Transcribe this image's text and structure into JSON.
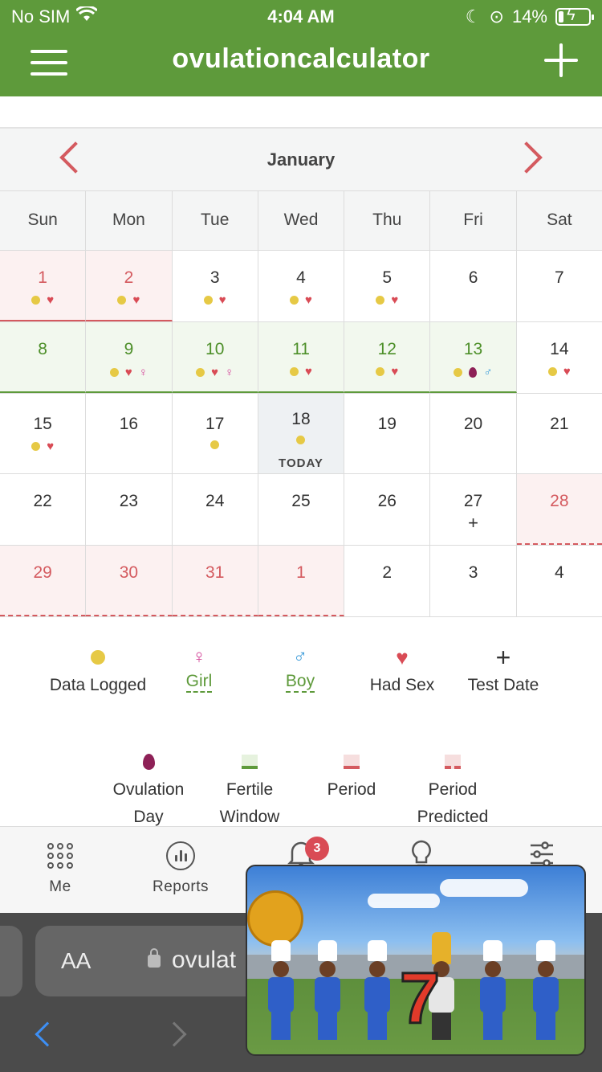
{
  "status": {
    "carrier": "No SIM",
    "time": "4:04 AM",
    "battery": "14%"
  },
  "app": {
    "title": "ovulationcalculator"
  },
  "calendar": {
    "month": "January",
    "weekdays": [
      "Sun",
      "Mon",
      "Tue",
      "Wed",
      "Thu",
      "Fri",
      "Sat"
    ],
    "today_label": "TODAY",
    "rows": [
      [
        "1",
        "2",
        "3",
        "4",
        "5",
        "6",
        "7"
      ],
      [
        "8",
        "9",
        "10",
        "11",
        "12",
        "13",
        "14"
      ],
      [
        "15",
        "16",
        "17",
        "18",
        "19",
        "20",
        "21"
      ],
      [
        "22",
        "23",
        "24",
        "25",
        "26",
        "27",
        "28"
      ],
      [
        "29",
        "30",
        "31",
        "1",
        "2",
        "3",
        "4"
      ]
    ],
    "test_date_symbol": "+"
  },
  "legend": {
    "data_logged": "Data Logged",
    "girl": "Girl",
    "boy": "Boy",
    "had_sex": "Had Sex",
    "test_date": "Test Date",
    "ovulation_day": "Ovulation Day",
    "fertile_window": "Fertile Window",
    "period": "Period",
    "period_predicted": "Period Predicted"
  },
  "nav": {
    "me": "Me",
    "reports": "Reports",
    "notifications_badge": "3"
  },
  "browser": {
    "aa": "AA",
    "url": "ovulat"
  },
  "video": {
    "number": "7"
  },
  "colors": {
    "brand_green": "#5e9a3b",
    "period_red": "#d45a5f",
    "data_yellow": "#e6c945",
    "ovulation_purple": "#8e2157"
  }
}
